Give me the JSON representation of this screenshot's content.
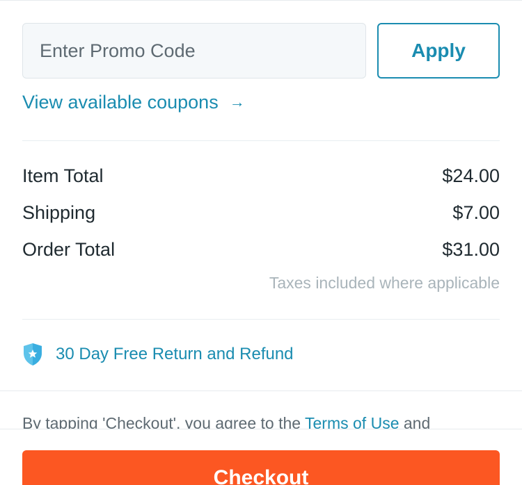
{
  "promo": {
    "placeholder": "Enter Promo Code",
    "value": "",
    "apply_label": "Apply"
  },
  "coupons": {
    "link_label": "View available coupons",
    "arrow_icon": "arrow-right-icon"
  },
  "summary": {
    "item_total_label": "Item Total",
    "item_total_value": "$24.00",
    "shipping_label": "Shipping",
    "shipping_value": "$7.00",
    "order_total_label": "Order Total",
    "order_total_value": "$31.00",
    "tax_note": "Taxes included where applicable"
  },
  "guarantee": {
    "icon": "shield-star-icon",
    "label": "30 Day Free Return and Refund"
  },
  "legal": {
    "prefix": "By tapping 'Checkout', you agree to the ",
    "terms_link": "Terms of Use",
    "suffix": " and"
  },
  "checkout": {
    "label": "Checkout"
  },
  "colors": {
    "accent": "#1a8cb0",
    "checkout": "#fc5722",
    "muted_text": "#a9b4ba",
    "input_bg": "#f5f8fa"
  }
}
